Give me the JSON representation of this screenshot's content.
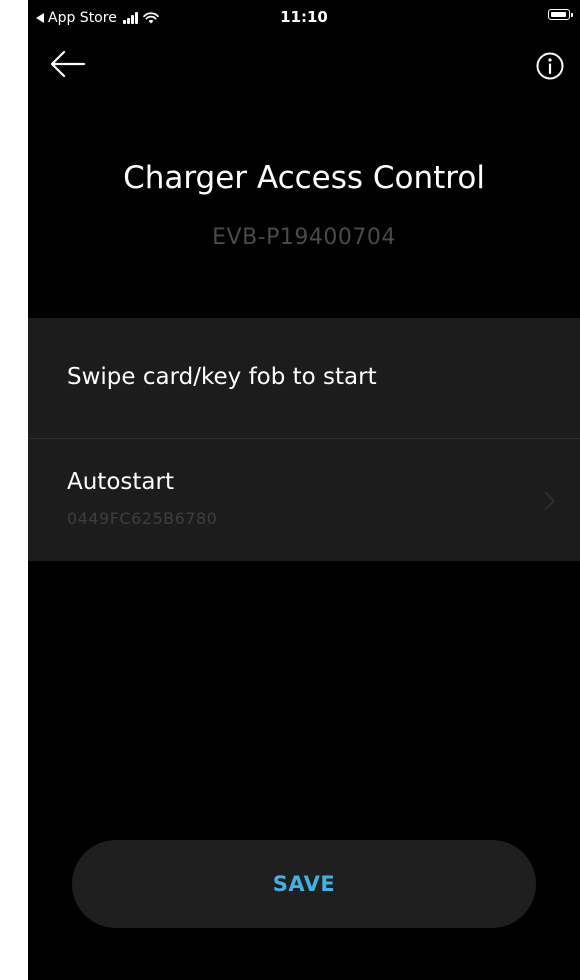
{
  "status_bar": {
    "back_app": "App Store",
    "time": "11:10"
  },
  "nav": {
    "back_icon": "arrow-left-icon",
    "info_icon": "info-circle-icon"
  },
  "header": {
    "title": "Charger Access Control",
    "device_id": "EVB-P19400704"
  },
  "options": {
    "swipe_label": "Swipe card/key fob to start",
    "autostart_label": "Autostart",
    "autostart_value": "0449FC625B6780"
  },
  "actions": {
    "save_label": "SAVE"
  },
  "colors": {
    "background": "#000000",
    "list_background": "#1c1c1c",
    "accent": "#3fb1e3",
    "muted_text": "#4a4a4a"
  }
}
